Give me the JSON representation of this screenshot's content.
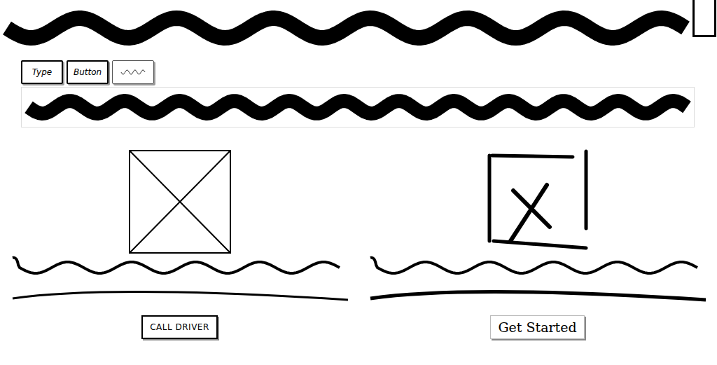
{
  "tabs": [
    {
      "label": "Type",
      "kind": "text"
    },
    {
      "label": "Button",
      "kind": "text"
    },
    {
      "kind": "scribble"
    }
  ],
  "cards": [
    {
      "button": "CALL DRIVER",
      "kind": "boxed"
    },
    {
      "button": "Get Started",
      "kind": "plain"
    }
  ]
}
